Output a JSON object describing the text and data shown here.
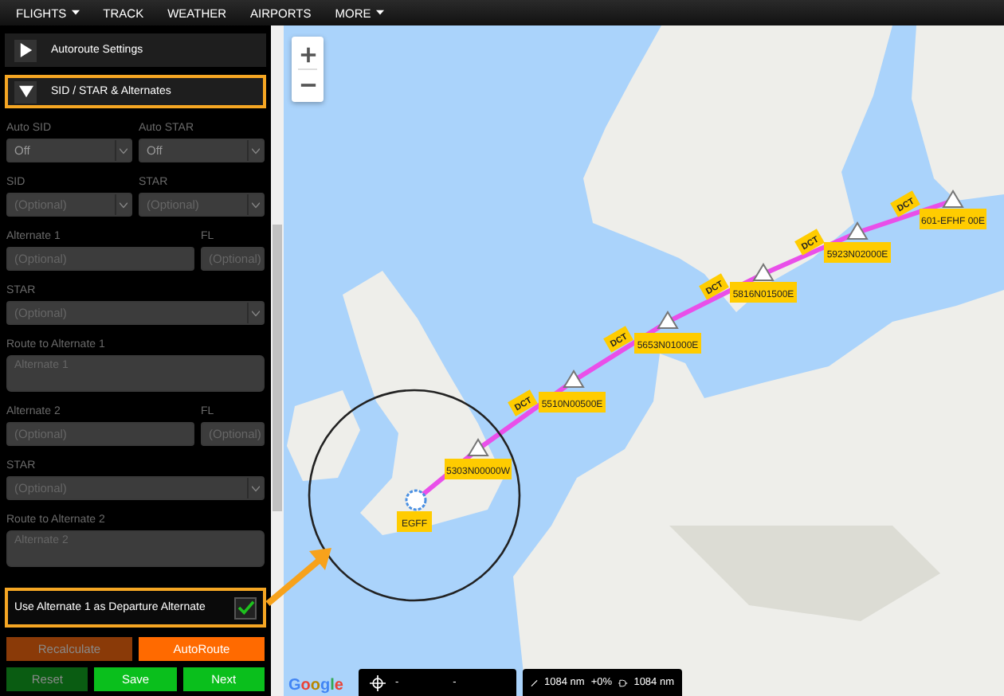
{
  "nav": {
    "items": [
      {
        "label": "FLIGHTS",
        "dropdown": true
      },
      {
        "label": "TRACK",
        "dropdown": false
      },
      {
        "label": "WEATHER",
        "dropdown": false
      },
      {
        "label": "AIRPORTS",
        "dropdown": false
      },
      {
        "label": "MORE",
        "dropdown": true
      }
    ]
  },
  "sidebar": {
    "sections": [
      {
        "title": "Autoroute Settings",
        "expanded": false,
        "highlighted": false
      },
      {
        "title": "SID / STAR & Alternates",
        "expanded": true,
        "highlighted": true
      }
    ],
    "rows": [
      {
        "kind": "pair",
        "fields": [
          {
            "label": "Auto SID",
            "kind": "select",
            "value": "Off"
          },
          {
            "label": "Auto STAR",
            "kind": "select",
            "value": "Off"
          }
        ]
      },
      {
        "kind": "pair",
        "fields": [
          {
            "label": "SID",
            "kind": "select",
            "placeholder": "(Optional)"
          },
          {
            "label": "STAR",
            "kind": "select",
            "placeholder": "(Optional)"
          }
        ]
      },
      {
        "kind": "alternate",
        "fields": [
          {
            "label": "Alternate 1",
            "kind": "input",
            "placeholder": "(Optional)"
          },
          {
            "label": "FL",
            "kind": "input",
            "placeholder": "(Optional)"
          }
        ]
      },
      {
        "kind": "single",
        "fields": [
          {
            "label": "STAR",
            "kind": "select",
            "placeholder": "(Optional)"
          }
        ]
      },
      {
        "kind": "single",
        "fields": [
          {
            "label": "Route to Alternate 1",
            "kind": "textarea",
            "placeholder": "Alternate 1"
          }
        ]
      },
      {
        "kind": "alternate",
        "fields": [
          {
            "label": "Alternate 2",
            "kind": "input",
            "placeholder": "(Optional)"
          },
          {
            "label": "FL",
            "kind": "input",
            "placeholder": "(Optional)"
          }
        ]
      },
      {
        "kind": "single",
        "fields": [
          {
            "label": "STAR",
            "kind": "select",
            "placeholder": "(Optional)"
          }
        ]
      },
      {
        "kind": "single",
        "fields": [
          {
            "label": "Route to Alternate 2",
            "kind": "textarea",
            "placeholder": "Alternate 2"
          }
        ]
      }
    ],
    "departure_alternate": {
      "label": "Use Alternate 1 as Departure Alternate",
      "checked": true,
      "highlighted": true
    },
    "button_rows": [
      [
        {
          "label": "Recalculate",
          "kind": "orange",
          "disabled": true
        },
        {
          "label": "AutoRoute",
          "kind": "orange",
          "disabled": false
        }
      ],
      [
        {
          "label": "Reset",
          "kind": "green",
          "disabled": true
        },
        {
          "label": "Save",
          "kind": "green",
          "disabled": false
        },
        {
          "label": "Next",
          "kind": "green",
          "disabled": false
        }
      ]
    ]
  },
  "map": {
    "departure": {
      "name": "EGFF"
    },
    "waypoints": [
      {
        "name": "5303N00000W"
      },
      {
        "name": "5510N00500E",
        "airway": "DCT"
      },
      {
        "name": "5653N01000E",
        "airway": "DCT"
      },
      {
        "name": "5816N01500E",
        "airway": "DCT"
      },
      {
        "name": "5923N02000E",
        "airway": "DCT"
      },
      {
        "name": "601-EFHF 00E",
        "airway": "DCT"
      }
    ],
    "logo": "Google",
    "position": {
      "latitude": "-",
      "longitude": "-"
    },
    "distance": {
      "route": "1084 nm",
      "difference": "+0%",
      "direct": "1084 nm"
    }
  }
}
